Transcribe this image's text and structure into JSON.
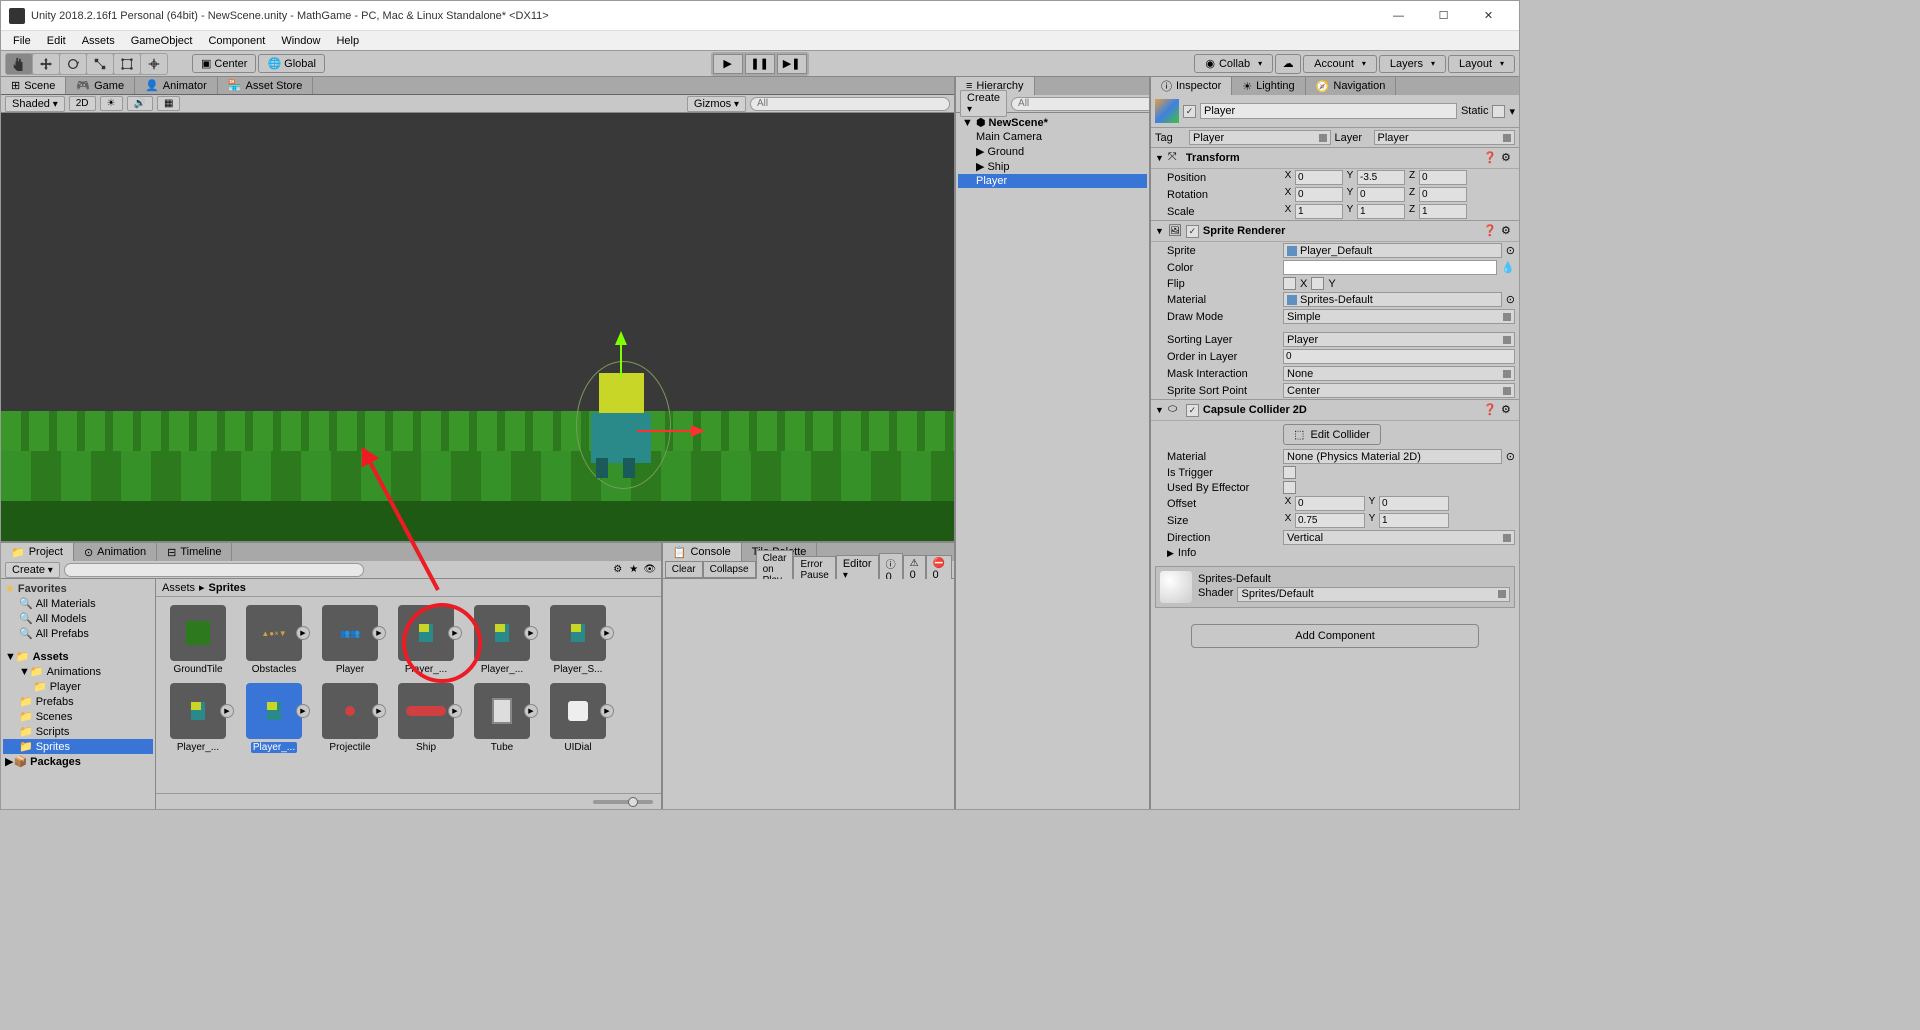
{
  "titlebar": {
    "text": "Unity 2018.2.16f1 Personal (64bit) - NewScene.unity - MathGame - PC, Mac & Linux Standalone* <DX11>"
  },
  "menubar": [
    "File",
    "Edit",
    "Assets",
    "GameObject",
    "Component",
    "Window",
    "Help"
  ],
  "toolbar": {
    "center": "Center",
    "global": "Global",
    "collab": "Collab",
    "account": "Account",
    "layers": "Layers",
    "layout": "Layout"
  },
  "scene_tabs": {
    "scene": "Scene",
    "game": "Game",
    "animator": "Animator",
    "asset_store": "Asset Store"
  },
  "scene_toolbar": {
    "shaded": "Shaded",
    "mode_2d": "2D",
    "gizmos": "Gizmos",
    "search_placeholder": "All"
  },
  "hierarchy": {
    "title": "Hierarchy",
    "create": "Create",
    "search_placeholder": "All",
    "scene_name": "NewScene*",
    "items": [
      "Main Camera",
      "Ground",
      "Ship",
      "Player"
    ],
    "selected": "Player"
  },
  "inspector": {
    "tabs": {
      "inspector": "Inspector",
      "lighting": "Lighting",
      "navigation": "Navigation"
    },
    "name": "Player",
    "static_label": "Static",
    "tag_label": "Tag",
    "tag_value": "Player",
    "layer_label": "Layer",
    "layer_value": "Player",
    "transform": {
      "title": "Transform",
      "position": {
        "label": "Position",
        "x": "0",
        "y": "-3.5",
        "z": "0"
      },
      "rotation": {
        "label": "Rotation",
        "x": "0",
        "y": "0",
        "z": "0"
      },
      "scale": {
        "label": "Scale",
        "x": "1",
        "y": "1",
        "z": "1"
      }
    },
    "sprite_renderer": {
      "title": "Sprite Renderer",
      "sprite_label": "Sprite",
      "sprite_value": "Player_Default",
      "color_label": "Color",
      "flip_label": "Flip",
      "flip_x": "X",
      "flip_y": "Y",
      "material_label": "Material",
      "material_value": "Sprites-Default",
      "draw_mode_label": "Draw Mode",
      "draw_mode_value": "Simple",
      "sorting_layer_label": "Sorting Layer",
      "sorting_layer_value": "Player",
      "order_label": "Order in Layer",
      "order_value": "0",
      "mask_label": "Mask Interaction",
      "mask_value": "None",
      "sort_point_label": "Sprite Sort Point",
      "sort_point_value": "Center"
    },
    "capsule": {
      "title": "Capsule Collider 2D",
      "edit_collider": "Edit Collider",
      "material_label": "Material",
      "material_value": "None (Physics Material 2D)",
      "trigger_label": "Is Trigger",
      "effector_label": "Used By Effector",
      "offset_label": "Offset",
      "offset_x": "0",
      "offset_y": "0",
      "size_label": "Size",
      "size_x": "0.75",
      "size_y": "1",
      "direction_label": "Direction",
      "direction_value": "Vertical"
    },
    "info_label": "Info",
    "material_preview": {
      "name": "Sprites-Default",
      "shader_label": "Shader",
      "shader_value": "Sprites/Default"
    },
    "add_component": "Add Component"
  },
  "project": {
    "tabs": {
      "project": "Project",
      "animation": "Animation",
      "timeline": "Timeline"
    },
    "create": "Create",
    "favorites": {
      "title": "Favorites",
      "items": [
        "All Materials",
        "All Models",
        "All Prefabs"
      ]
    },
    "assets": {
      "title": "Assets",
      "folders": [
        "Animations",
        "Prefabs",
        "Scenes",
        "Scripts",
        "Sprites"
      ],
      "anim_sub": "Player",
      "packages": "Packages"
    },
    "breadcrumb": [
      "Assets",
      "Sprites"
    ],
    "grid_items": [
      {
        "label": "GroundTile",
        "play": false
      },
      {
        "label": "Obstacles",
        "play": true
      },
      {
        "label": "Player",
        "play": true
      },
      {
        "label": "Player_...",
        "play": true,
        "highlighted": true
      },
      {
        "label": "Player_...",
        "play": true
      },
      {
        "label": "Player_S...",
        "play": true
      },
      {
        "label": "Player_...",
        "play": true
      },
      {
        "label": "Player_...",
        "play": true,
        "selected": true
      },
      {
        "label": "Projectile",
        "play": true
      },
      {
        "label": "Ship",
        "play": true
      },
      {
        "label": "Tube",
        "play": true
      },
      {
        "label": "UIDial",
        "play": true
      }
    ]
  },
  "console": {
    "tabs": {
      "console": "Console",
      "tile_palette": "Tile Palette"
    },
    "buttons": [
      "Clear",
      "Collapse",
      "Clear on Play",
      "Error Pause",
      "Editor"
    ],
    "counts": [
      "0",
      "0",
      "0"
    ]
  }
}
